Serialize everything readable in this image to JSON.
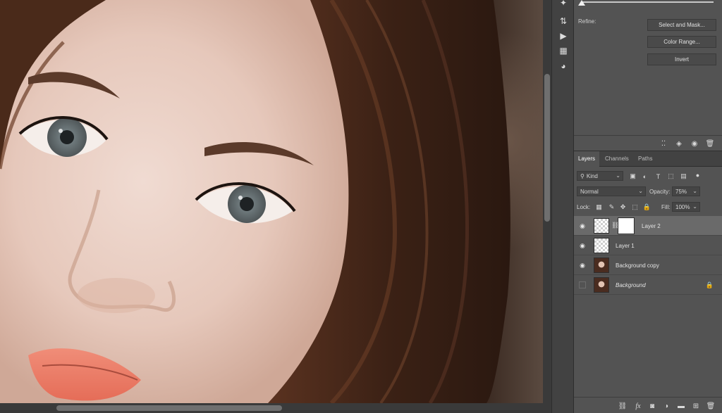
{
  "properties": {
    "refine_label": "Refine:",
    "select_and_mask": "Select and Mask...",
    "color_range": "Color Range...",
    "invert": "Invert"
  },
  "layers_panel": {
    "tabs": [
      "Layers",
      "Channels",
      "Paths"
    ],
    "filter_kind": "Kind",
    "blend_mode": "Normal",
    "opacity_label": "Opacity:",
    "opacity_value": "75%",
    "lock_label": "Lock:",
    "fill_label": "Fill:",
    "fill_value": "100%",
    "layers": [
      {
        "name": "Layer 2",
        "visible": true,
        "selected": true,
        "has_mask": true
      },
      {
        "name": "Layer 1",
        "visible": true,
        "selected": false
      },
      {
        "name": "Background copy",
        "visible": true,
        "selected": false
      },
      {
        "name": "Background",
        "visible": false,
        "selected": false,
        "locked": true
      }
    ]
  },
  "icons": {
    "eye": "eye-icon",
    "lock": "lock-icon",
    "fx": "fx"
  }
}
